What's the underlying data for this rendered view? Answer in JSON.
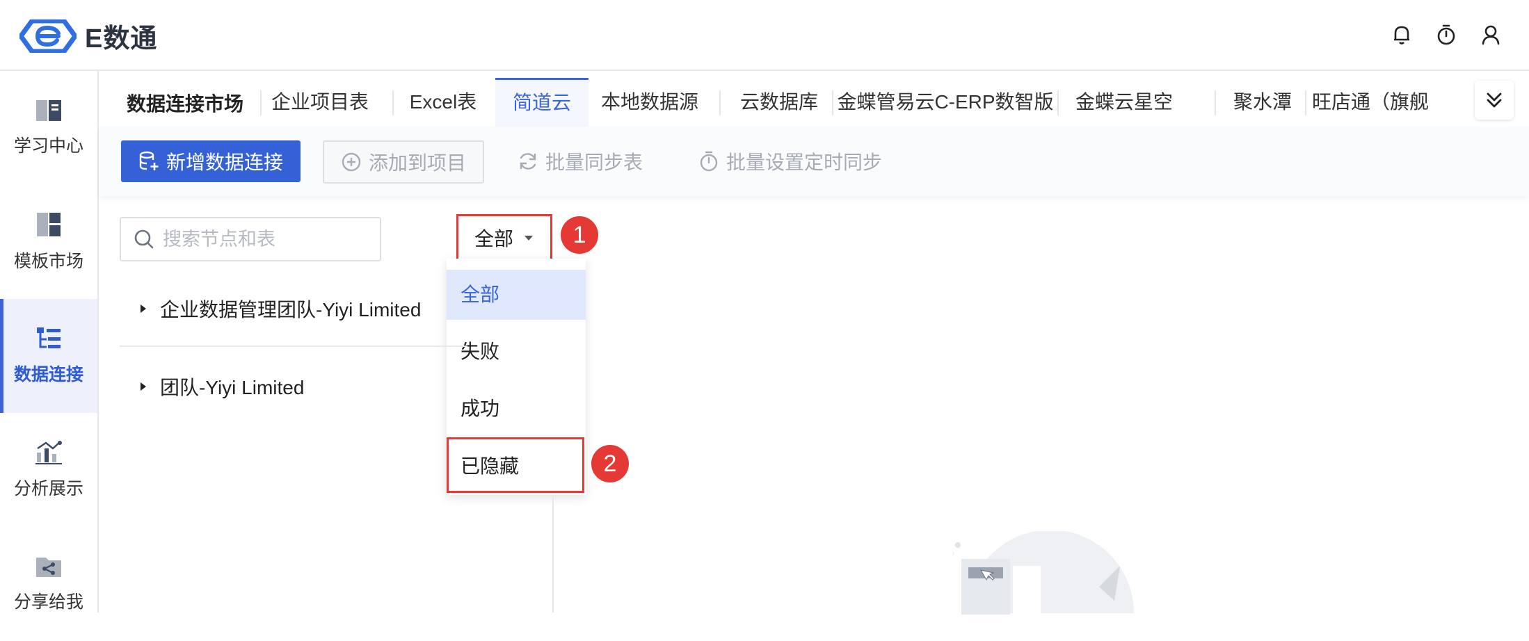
{
  "app": {
    "logo_text": "E数通"
  },
  "header": {
    "icons": [
      "bell-icon",
      "timer-icon",
      "user-icon"
    ]
  },
  "sidebar": {
    "items": [
      {
        "label": "学习中心",
        "icon": "book-icon",
        "active": false
      },
      {
        "label": "模板市场",
        "icon": "template-icon",
        "active": false
      },
      {
        "label": "数据连接",
        "icon": "data-connect-icon",
        "active": true
      },
      {
        "label": "分析展示",
        "icon": "chart-icon",
        "active": false
      },
      {
        "label": "分享给我",
        "icon": "share-folder-icon",
        "active": false
      }
    ]
  },
  "tabs": {
    "title": "数据连接市场",
    "items": [
      {
        "label": "企业项目表"
      },
      {
        "label": "Excel表"
      },
      {
        "label": "简道云",
        "active": true
      },
      {
        "label": "本地数据源"
      },
      {
        "label": "云数据库"
      },
      {
        "label": "金蝶管易云C-ERP数智版"
      },
      {
        "label": "金蝶云星空"
      },
      {
        "label": "聚水潭"
      },
      {
        "label": "旺店通（旗舰"
      }
    ]
  },
  "toolbar": {
    "new_connection": "新增数据连接",
    "add_to_project": "添加到项目",
    "batch_sync": "批量同步表",
    "batch_schedule": "批量设置定时同步"
  },
  "search": {
    "placeholder": "搜索节点和表",
    "value": ""
  },
  "filter": {
    "selected": "全部",
    "options": [
      "全部",
      "失败",
      "成功",
      "已隐藏"
    ]
  },
  "annotations": {
    "step1": "1",
    "step2": "2"
  },
  "tree": {
    "items": [
      {
        "label": "企业数据管理团队-Yiyi Limited"
      },
      {
        "label": "团队-Yiyi Limited"
      }
    ]
  },
  "colors": {
    "primary": "#3462d6",
    "accent": "#3b65d9",
    "highlight": "#e53935"
  }
}
